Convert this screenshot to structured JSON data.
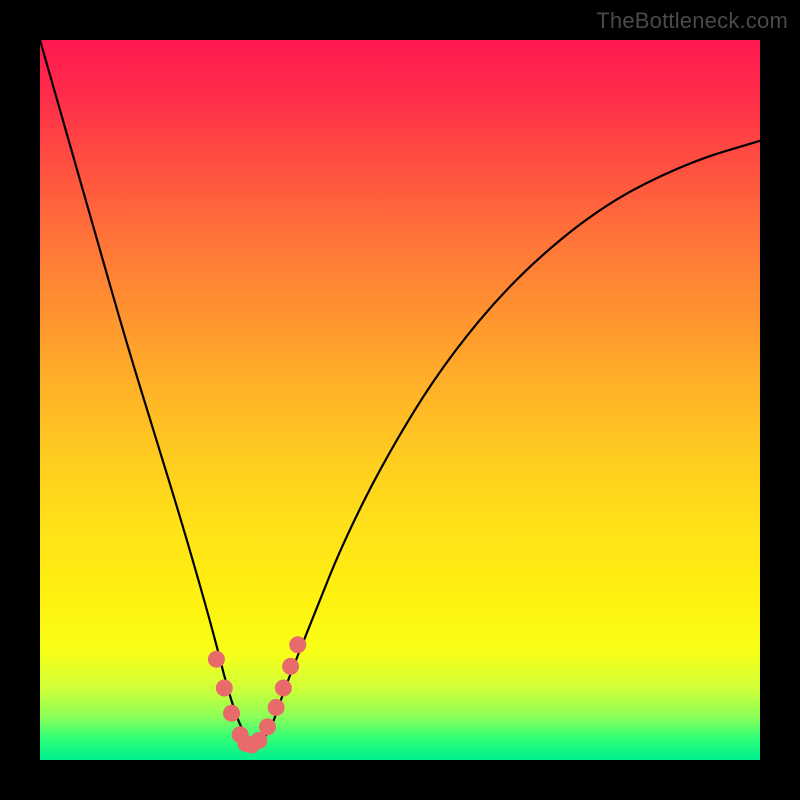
{
  "watermark": "TheBottleneck.com",
  "chart_data": {
    "type": "line",
    "title": "",
    "xlabel": "",
    "ylabel": "",
    "xlim": [
      0,
      100
    ],
    "ylim": [
      0,
      100
    ],
    "grid": false,
    "series": [
      {
        "name": "bottleneck-curve",
        "color": "#000000",
        "x": [
          0,
          4,
          8,
          12,
          16,
          20,
          24,
          26,
          28,
          30,
          32,
          34,
          38,
          42,
          48,
          56,
          66,
          78,
          90,
          100
        ],
        "y": [
          100,
          86,
          72,
          58,
          45,
          32,
          18,
          10,
          4,
          2,
          4,
          10,
          20,
          30,
          42,
          55,
          67,
          77,
          83,
          86
        ]
      },
      {
        "name": "trough-highlight",
        "color": "#e86a6a",
        "x": [
          24.5,
          25.6,
          26.6,
          27.8,
          28.6,
          29.4,
          30.4,
          31.6,
          32.8,
          33.8,
          34.8,
          35.8
        ],
        "y": [
          14.0,
          10.0,
          6.5,
          3.5,
          2.3,
          2.1,
          2.7,
          4.6,
          7.3,
          10.0,
          13.0,
          16.0
        ]
      }
    ]
  }
}
